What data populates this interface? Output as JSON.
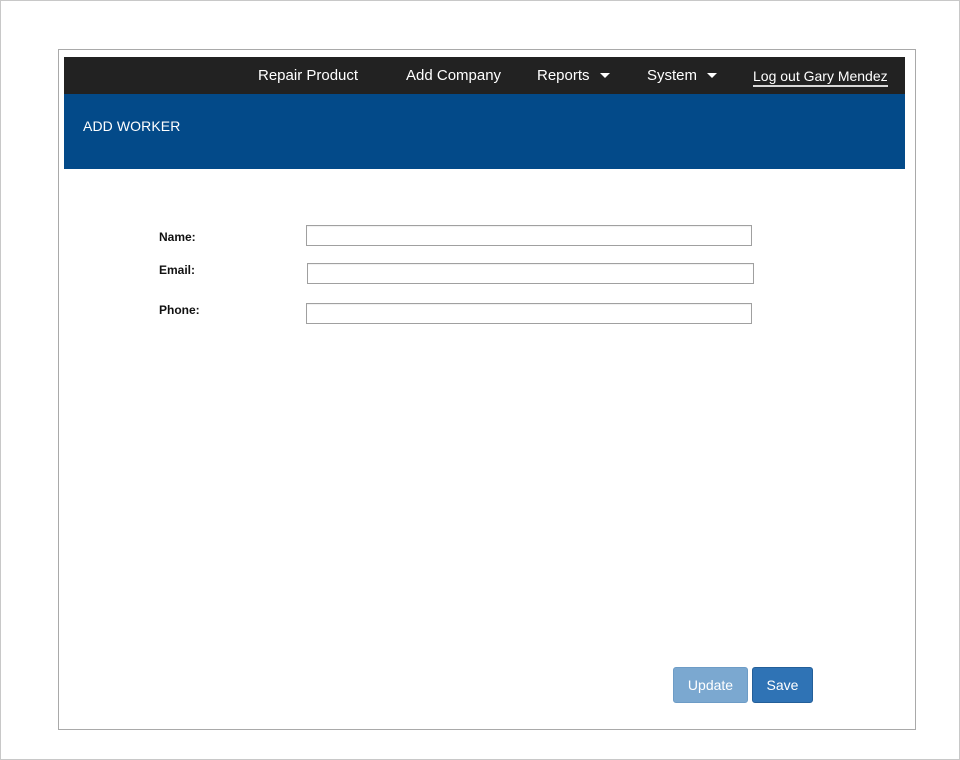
{
  "nav": {
    "repair_product": "Repair Product",
    "add_company": "Add Company",
    "reports": "Reports",
    "system": "System",
    "logout": "Log out Gary Mendez"
  },
  "header": {
    "title": "ADD WORKER"
  },
  "form": {
    "name_label": "Name:",
    "name_value": "",
    "email_label": "Email:",
    "email_value": "",
    "phone_label": "Phone:",
    "phone_value": ""
  },
  "actions": {
    "update_label": "Update",
    "save_label": "Save"
  },
  "colors": {
    "navbar": "#222222",
    "header_band": "#034a89",
    "update_button": "#7ba8d0",
    "save_button": "#2f73b5"
  }
}
